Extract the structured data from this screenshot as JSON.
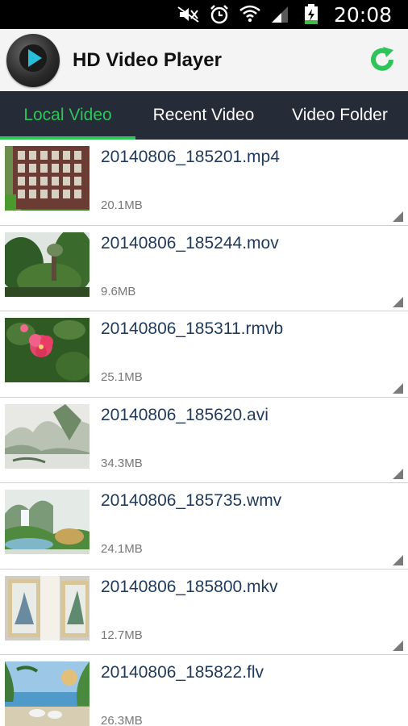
{
  "status_bar": {
    "time": "20:08",
    "icons": [
      "mute-icon",
      "alarm-icon",
      "wifi-icon",
      "signal-icon",
      "battery-charging-icon"
    ]
  },
  "header": {
    "title": "HD Video Player",
    "logo_icon": "play-icon",
    "refresh_icon": "refresh-icon"
  },
  "tabs": [
    {
      "label": "Local Video",
      "active": true
    },
    {
      "label": "Recent Video",
      "active": false
    },
    {
      "label": "Video Folder",
      "active": false
    }
  ],
  "colors": {
    "accent": "#2fc45a",
    "tab_bar_bg": "#262b38",
    "file_name": "#1f3a5a"
  },
  "videos": [
    {
      "name": "20140806_185201.mp4",
      "size": "20.1MB",
      "thumb": "fence"
    },
    {
      "name": "20140806_185244.mov",
      "size": "9.6MB",
      "thumb": "trees"
    },
    {
      "name": "20140806_185311.rmvb",
      "size": "25.1MB",
      "thumb": "flower"
    },
    {
      "name": "20140806_185620.avi",
      "size": "34.3MB",
      "thumb": "misty-mountains"
    },
    {
      "name": "20140806_185735.wmv",
      "size": "24.1MB",
      "thumb": "waterfall-painting"
    },
    {
      "name": "20140806_185800.mkv",
      "size": "12.7MB",
      "thumb": "framed-paintings"
    },
    {
      "name": "20140806_185822.flv",
      "size": "26.3MB",
      "thumb": "seaside-mural"
    }
  ]
}
